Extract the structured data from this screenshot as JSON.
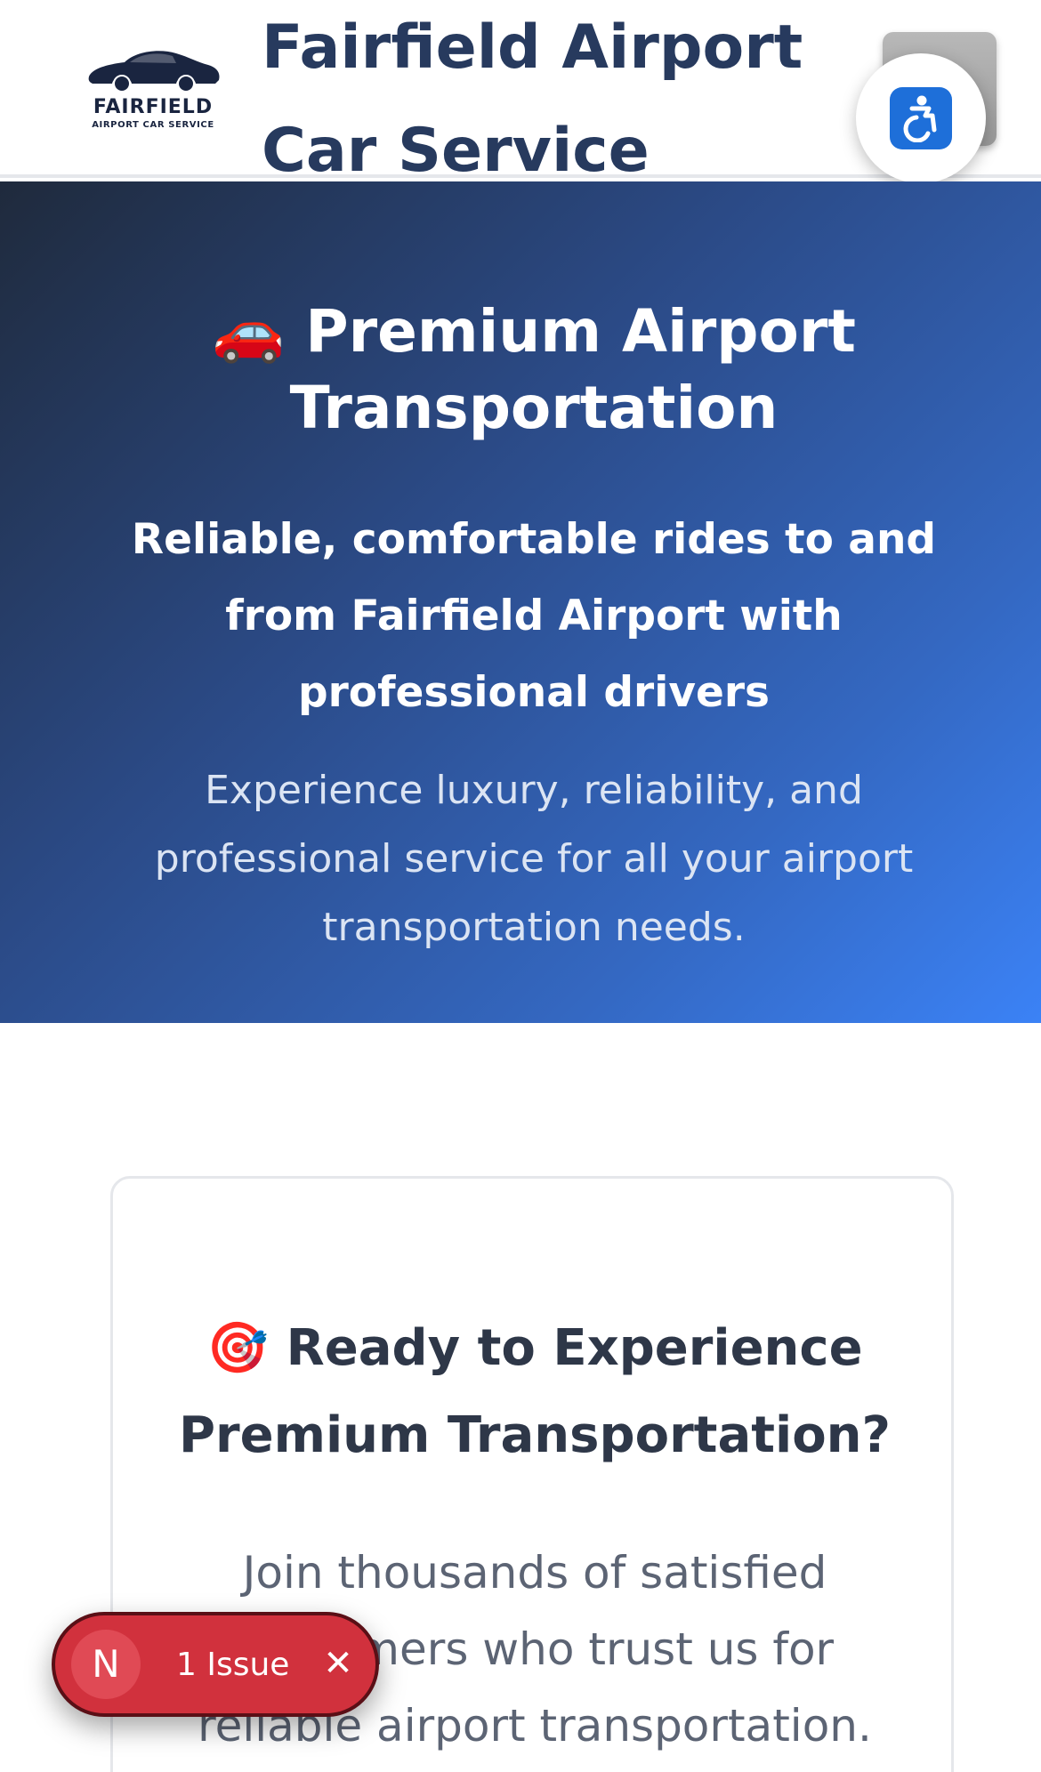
{
  "header": {
    "logo_wordmark": "FAIRFIELD",
    "logo_subtitle": "AIRPORT CAR SERVICE",
    "title_line1": "Fairfield Airport",
    "title_line2": "Car Service",
    "menu_icon": "menu-icon",
    "accessibility_icon": "accessibility-icon"
  },
  "hero": {
    "title_emoji": "🚗",
    "title": "Premium Airport Transportation",
    "subtitle": "Reliable, comfortable rides to and from Fairfield Airport with professional drivers",
    "description": "Experience luxury, reliability, and professional service for all your airport transportation needs."
  },
  "cta_card": {
    "title_emoji": "🎯",
    "title": "Ready to Experience Premium Transportation?",
    "text": "Join thousands of satisfied customers who trust us for reliable airport transportation."
  },
  "issues_badge": {
    "avatar_letter": "N",
    "label": "1 Issue",
    "close_glyph": "✕"
  },
  "colors": {
    "brand_dark": "#273a5e",
    "brand_accent": "#2f5ea8",
    "hero_gradient_start": "#1f2a3c",
    "hero_gradient_end": "#3b82f6",
    "issue_red": "#d1313d",
    "a11y_blue": "#1e6fd9"
  }
}
